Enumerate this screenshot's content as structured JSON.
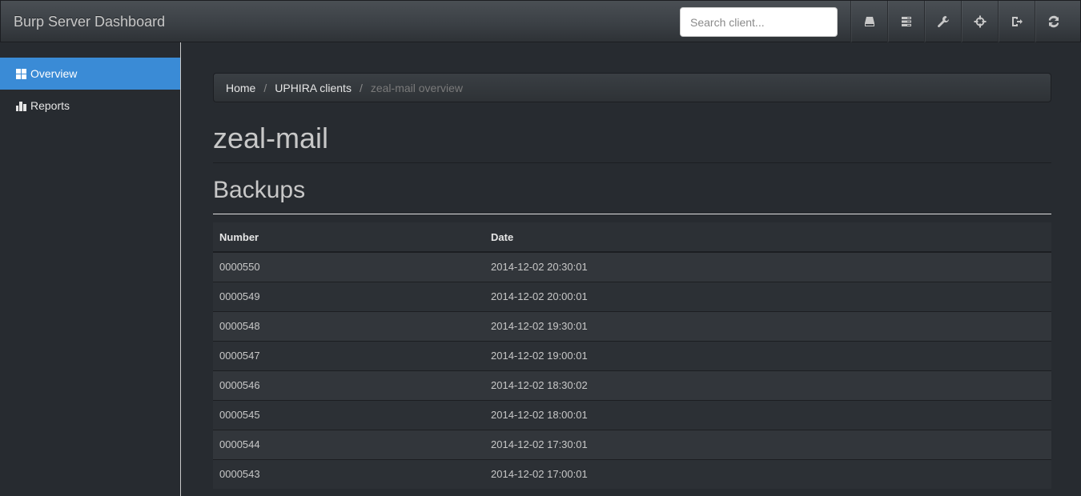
{
  "navbar": {
    "brand": "Burp Server Dashboard",
    "search_placeholder": "Search client...",
    "buttons": [
      {
        "icon": "hdd-icon"
      },
      {
        "icon": "tasks-icon"
      },
      {
        "icon": "wrench-icon"
      },
      {
        "icon": "crosshair-icon"
      },
      {
        "icon": "logout-icon"
      },
      {
        "icon": "refresh-icon"
      }
    ]
  },
  "sidebar": {
    "items": [
      {
        "label": "Overview",
        "icon": "dashboard-icon",
        "active": true
      },
      {
        "label": "Reports",
        "icon": "bar-chart-icon",
        "active": false
      }
    ]
  },
  "breadcrumb": {
    "home": "Home",
    "clients": "UPHIRA clients",
    "current": "zeal-mail overview",
    "separator": "/"
  },
  "page": {
    "title": "zeal-mail",
    "section": "Backups"
  },
  "table": {
    "headers": [
      "Number",
      "Date"
    ],
    "rows": [
      [
        "0000550",
        "2014-12-02 20:30:01"
      ],
      [
        "0000549",
        "2014-12-02 20:00:01"
      ],
      [
        "0000548",
        "2014-12-02 19:30:01"
      ],
      [
        "0000547",
        "2014-12-02 19:00:01"
      ],
      [
        "0000546",
        "2014-12-02 18:30:02"
      ],
      [
        "0000545",
        "2014-12-02 18:00:01"
      ],
      [
        "0000544",
        "2014-12-02 17:30:01"
      ],
      [
        "0000543",
        "2014-12-02 17:00:01"
      ]
    ]
  },
  "colors": {
    "background": "#272b30",
    "accent": "#3a8bd6"
  }
}
